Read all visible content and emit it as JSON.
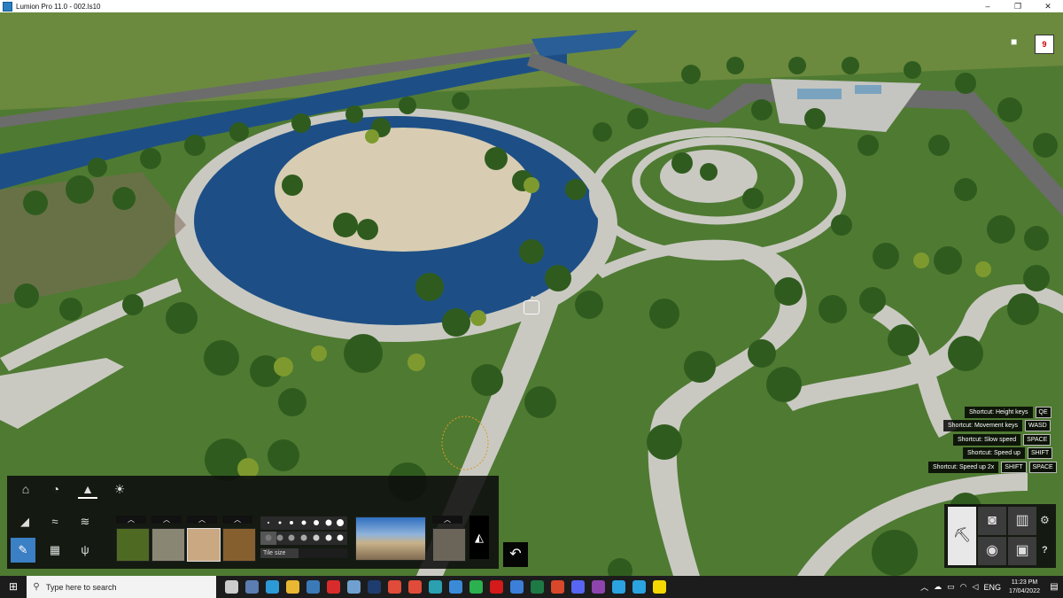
{
  "window": {
    "title": "Lumion Pro 11.0  - 002.ls10",
    "minimize": "–",
    "maximize": "❐",
    "close": "✕"
  },
  "viewport": {
    "camera_icon": "video-camera-icon",
    "sun_badge": "9",
    "colors": {
      "grass": "#4f7a32",
      "water": "#1d4f86",
      "path": "#c9c9c2",
      "sand": "#d8cdb2",
      "tree": "#2f5c1e"
    }
  },
  "shortcuts": [
    {
      "label": "Shortcut: Height keys",
      "keys": [
        "QE"
      ]
    },
    {
      "label": "Shortcut: Movement keys",
      "keys": [
        "WASD"
      ]
    },
    {
      "label": "Shortcut: Slow speed",
      "keys": [
        "SPACE"
      ]
    },
    {
      "label": "Shortcut: Speed up",
      "keys": [
        "SHIFT"
      ]
    },
    {
      "label": "Shortcut: Speed up 2x",
      "keys": [
        "SHIFT",
        "SPACE"
      ]
    }
  ],
  "landscape_panel": {
    "tabs": [
      "home-icon",
      "paint-icon",
      "landscape-icon",
      "weather-icon"
    ],
    "tools": [
      "height-icon",
      "water-icon",
      "ocean-icon",
      "paint-brush-icon",
      "import-icon",
      "grass-icon"
    ],
    "materials": [
      "grass-material",
      "gravel-material",
      "sand-material",
      "soil-material",
      "rock-material"
    ],
    "tile_size_label": "Tile size"
  },
  "right_panel": {
    "buttons": [
      "build-mode-icon",
      "photo-icon",
      "movie-icon",
      "panorama-icon",
      "save-icon"
    ],
    "settings_icon": "⚙",
    "help_icon": "?"
  },
  "taskbar": {
    "search_placeholder": "Type here to search",
    "language": "ENG",
    "time": "11:23 PM",
    "date": "17/04/2022",
    "apps": [
      {
        "name": "task-view",
        "color": "#cccccc"
      },
      {
        "name": "calculator",
        "color": "#5b7db1"
      },
      {
        "name": "edge",
        "color": "#2d9ad8"
      },
      {
        "name": "file-explorer",
        "color": "#e8b832"
      },
      {
        "name": "sketchup",
        "color": "#3a7ab8"
      },
      {
        "name": "acrobat",
        "color": "#d92b2b"
      },
      {
        "name": "lumion",
        "color": "#6fa0d0"
      },
      {
        "name": "photoshop",
        "color": "#1f3c6e"
      },
      {
        "name": "chrome",
        "color": "#e04b3a"
      },
      {
        "name": "chrome-2",
        "color": "#e04b3a"
      },
      {
        "name": "app-teal",
        "color": "#2aa0b0"
      },
      {
        "name": "app-blue",
        "color": "#3b8ad8"
      },
      {
        "name": "whatsapp",
        "color": "#2bb14d"
      },
      {
        "name": "opera",
        "color": "#d41a1a"
      },
      {
        "name": "todo",
        "color": "#3b7fd9"
      },
      {
        "name": "excel",
        "color": "#1d7a45"
      },
      {
        "name": "grammarly",
        "color": "#d9482b"
      },
      {
        "name": "discord",
        "color": "#5865f2"
      },
      {
        "name": "podcast",
        "color": "#8e44ad"
      },
      {
        "name": "telegram",
        "color": "#2aa3e0"
      },
      {
        "name": "telegram-2",
        "color": "#2aa3e0"
      },
      {
        "name": "sticky-notes",
        "color": "#f5d800"
      }
    ]
  }
}
